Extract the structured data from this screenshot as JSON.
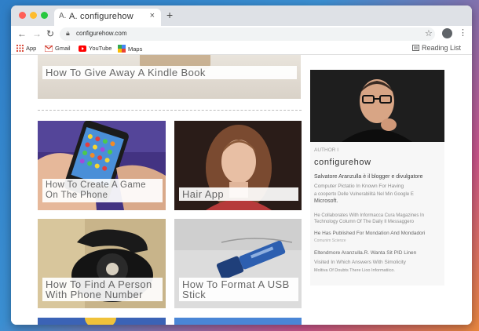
{
  "browser": {
    "tab_title": "A. configurehow",
    "tab_favicon": "A.",
    "new_tab_symbol": "+",
    "close_tab_symbol": "×",
    "url": "configurehow.com",
    "bookmarks": [
      {
        "label": "App",
        "icon": "apps-grid-icon"
      },
      {
        "label": "Gmail",
        "icon": "gmail-icon"
      },
      {
        "label": "YouTube",
        "icon": "youtube-icon"
      },
      {
        "label": "Maps",
        "icon": "maps-icon"
      }
    ],
    "reading_list": "Reading List",
    "colors": {
      "close": "#ff5f57",
      "minimize": "#febc2e",
      "zoom": "#28c840"
    }
  },
  "articles": {
    "top": "How To Give Away A Kindle Book",
    "game": "How To Create A Game On The Phone",
    "hair": "Hair App",
    "person": "How To Find A Person With Phone Number",
    "usb": "How To Format A USB Stick"
  },
  "sidebar": {
    "author_label": "AUTHOR I",
    "author_name": "configurehow",
    "bio1": "Salvatore Aranzulla è il blogger e divulgatore",
    "bio2": "Computer Pictatio In Known For Having",
    "bio3": "a cooperto Delle Vulnerabilità Nel Min Google E",
    "bio4": "Microsoft.",
    "bio5": "He Collaborates With Informacca Cura Magazines In Technology Column Of The Daily Il Messaggero",
    "bio6": "He Has Published For Mondation And Mondadori",
    "bio7": "Comunim Scienze",
    "bio8": "Eltendmore Aranzulla.R. Wanta Sit PID Linen",
    "bio9": "Visited In Which Answers With Simolicity",
    "bio10": "Moltiva Of Doubts There Lioo Informatiico."
  }
}
